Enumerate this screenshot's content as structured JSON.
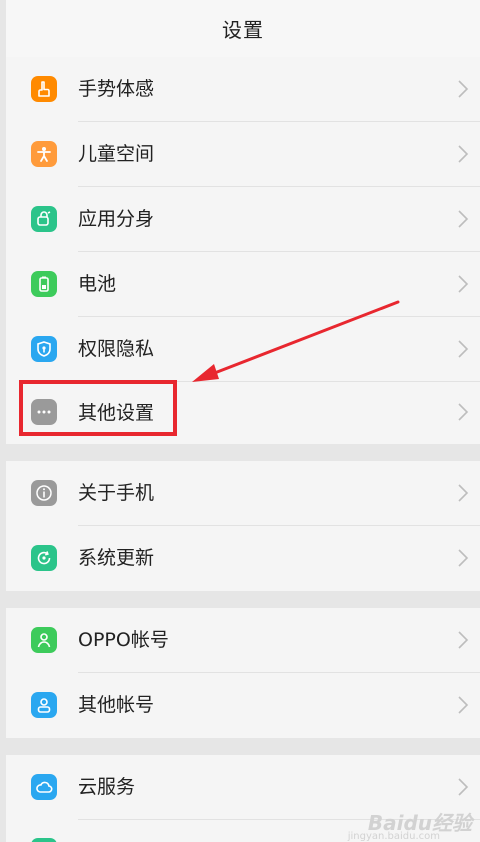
{
  "header": {
    "title": "设置"
  },
  "groups": [
    {
      "items": [
        {
          "label": "手势体感",
          "icon": "hand-gesture-icon",
          "color": "#FF8A00"
        },
        {
          "label": "儿童空间",
          "icon": "child-icon",
          "color": "#FF9B3B"
        },
        {
          "label": "应用分身",
          "icon": "app-clone-icon",
          "color": "#2BC48A"
        },
        {
          "label": "电池",
          "icon": "battery-icon",
          "color": "#3DCB5B"
        },
        {
          "label": "权限隐私",
          "icon": "shield-icon",
          "color": "#2AA7F0"
        },
        {
          "label": "其他设置",
          "icon": "more-dots-icon",
          "color": "#9A9A9A"
        }
      ]
    },
    {
      "items": [
        {
          "label": "关于手机",
          "icon": "info-icon",
          "color": "#9A9A9A"
        },
        {
          "label": "系统更新",
          "icon": "update-icon",
          "color": "#2BC48A"
        }
      ]
    },
    {
      "items": [
        {
          "label": "OPPO帐号",
          "icon": "account-icon",
          "color": "#3DCB5B"
        },
        {
          "label": "其他帐号",
          "icon": "user-icon",
          "color": "#2AA7F0"
        }
      ]
    },
    {
      "items": [
        {
          "label": "云服务",
          "icon": "cloud-icon",
          "color": "#2AA7F0"
        }
      ]
    }
  ],
  "annotation": {
    "highlight_color": "#E8272F"
  },
  "watermark": {
    "text": "Baidu经验",
    "sub": "jingyan.baidu.com"
  }
}
